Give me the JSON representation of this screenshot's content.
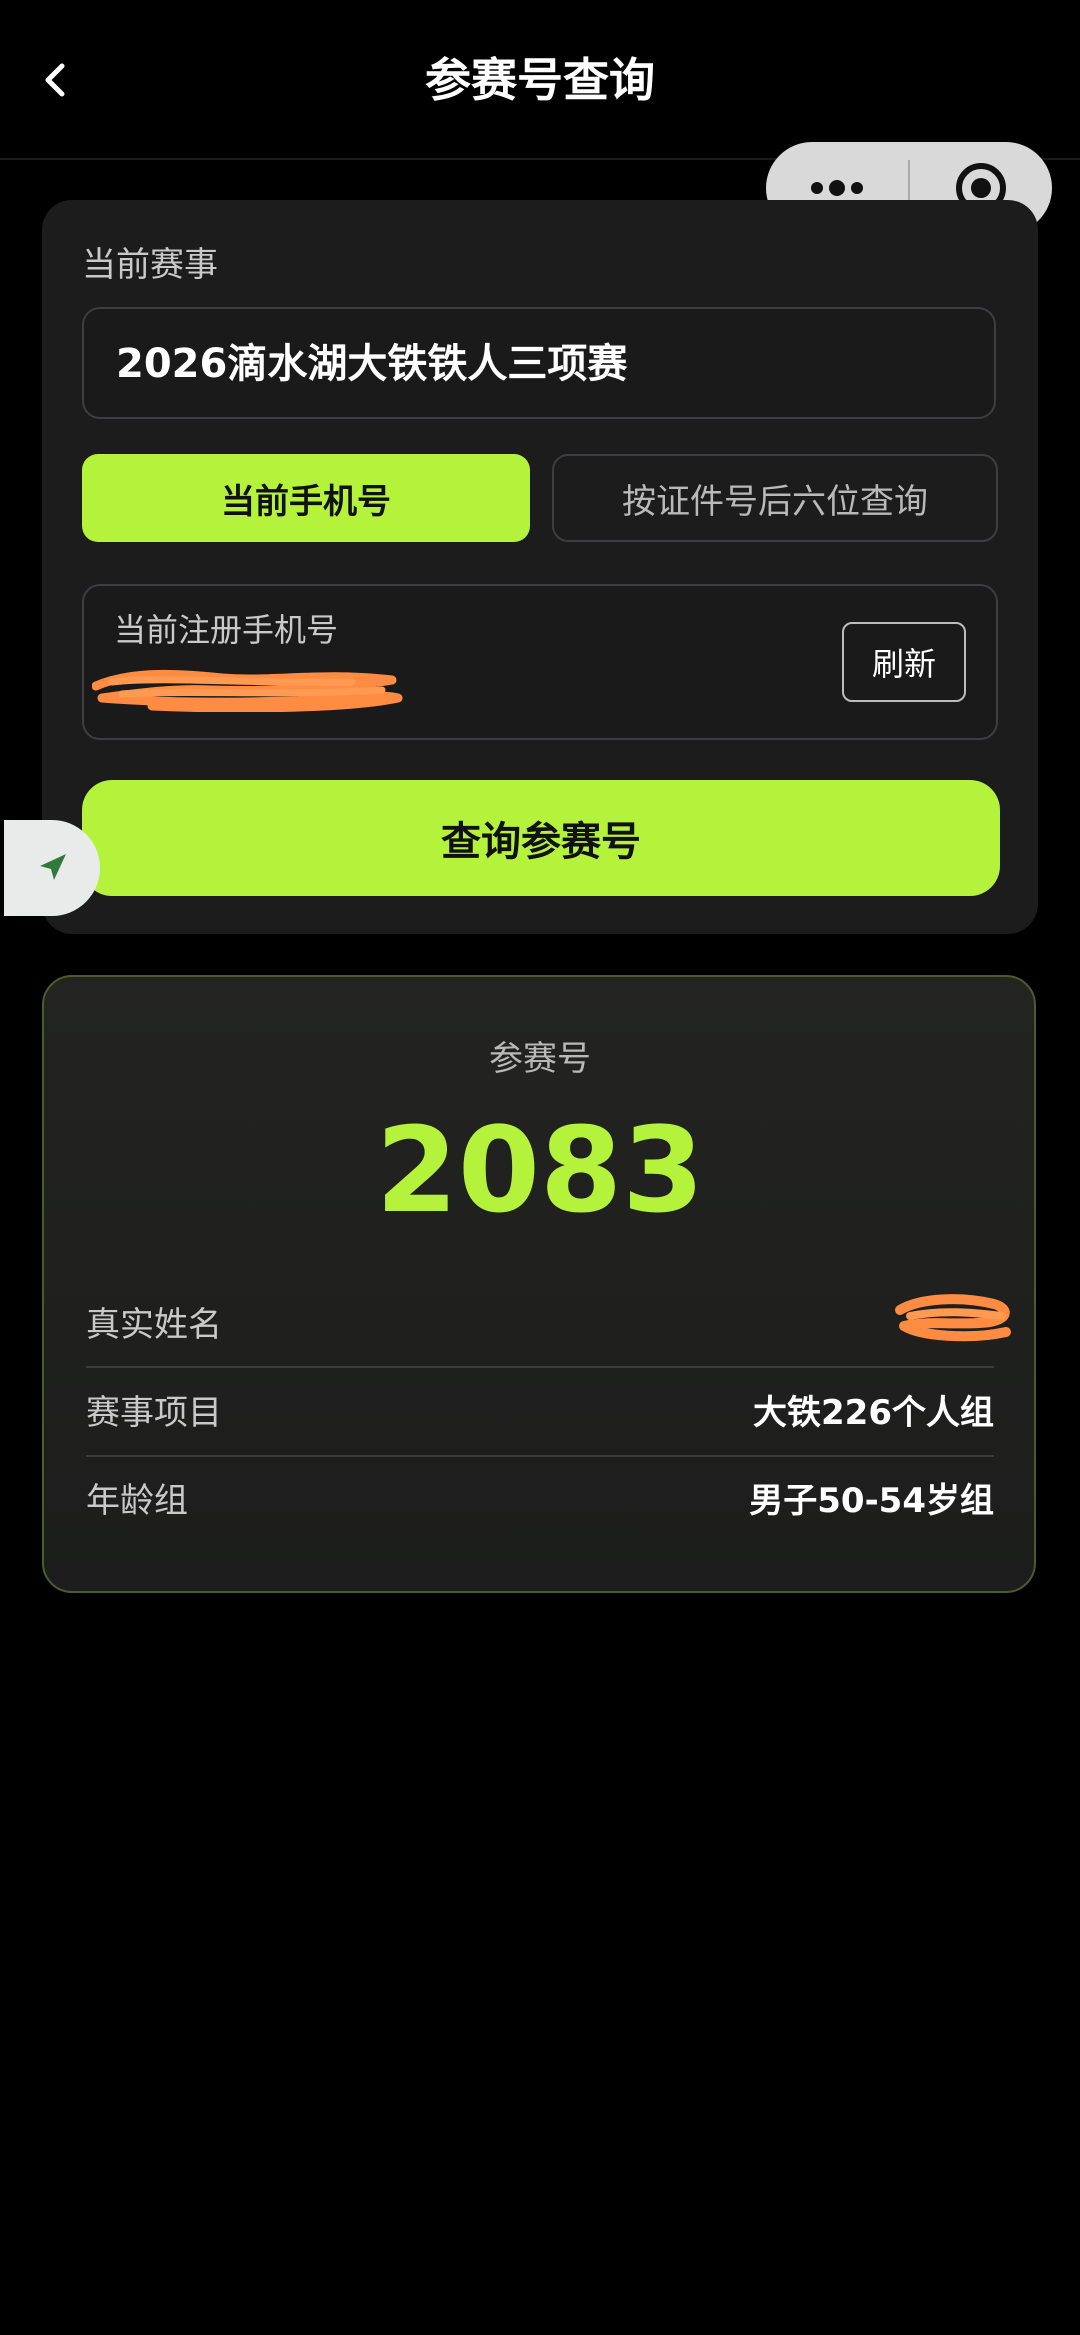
{
  "header": {
    "title": "参赛号查询",
    "back_icon": "chevron-left-icon",
    "capsule_more_icon": "more-dots-icon",
    "capsule_close_icon": "target-circle-icon"
  },
  "query": {
    "event_label": "当前赛事",
    "event_name": "2026滴水湖大铁铁人三项赛",
    "tabs": [
      {
        "label": "当前手机号",
        "selected": true
      },
      {
        "label": "按证件号后六位查询",
        "selected": false
      }
    ],
    "phone_label": "当前注册手机号",
    "refresh_label": "刷新",
    "submit_label": "查询参赛号"
  },
  "result": {
    "bib_label": "参赛号",
    "bib_number": "2083",
    "rows": [
      {
        "label": "真实姓名",
        "value": ""
      },
      {
        "label": "赛事项目",
        "value": "大铁226个人组"
      },
      {
        "label": "年龄组",
        "value": "男子50-54岁组"
      }
    ]
  },
  "colors": {
    "accent": "#b5f23c",
    "background": "#000000",
    "card": "#1c1c1d",
    "redaction": "#ff8c42"
  }
}
